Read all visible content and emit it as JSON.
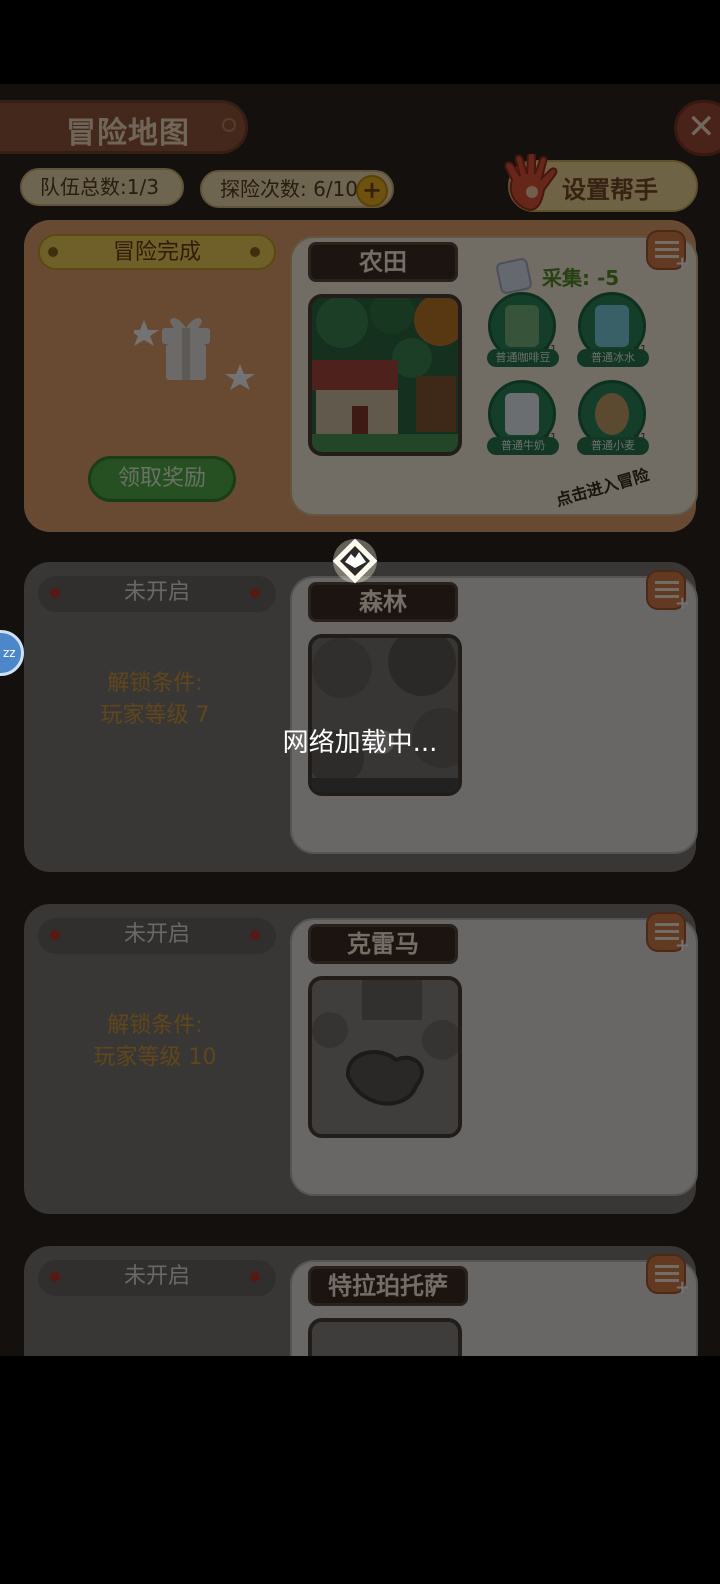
{
  "header": {
    "title": "冒险地图",
    "team_total": "队伍总数:1/3",
    "explore_count": "探险次数: 6/10",
    "add_label": "+",
    "help_label": "设置帮手",
    "close_label": "✕"
  },
  "cards": [
    {
      "status": "冒险完成",
      "map_name": "农田",
      "claim_label": "领取奖励",
      "collect": "采集: -5",
      "enter_hint": "点击进入冒险",
      "rewards": [
        {
          "label": "普通咖啡豆",
          "qty": "x1",
          "icon": "coffee-bean-icon"
        },
        {
          "label": "普通冰水",
          "qty": "x1",
          "icon": "ice-water-icon"
        },
        {
          "label": "普通牛奶",
          "qty": "x1",
          "icon": "milk-icon"
        },
        {
          "label": "普通小麦",
          "qty": "x1",
          "icon": "wheat-icon"
        }
      ]
    },
    {
      "status": "未开启",
      "map_name": "森林",
      "unlock_title": "解锁条件:",
      "unlock_req": "玩家等级 7"
    },
    {
      "status": "未开启",
      "map_name": "克雷马",
      "unlock_title": "解锁条件:",
      "unlock_req": "玩家等级 10"
    },
    {
      "status": "未开启",
      "map_name": "特拉珀托萨"
    }
  ],
  "loading_text": "网络加载中...",
  "side_bubble": "zz"
}
